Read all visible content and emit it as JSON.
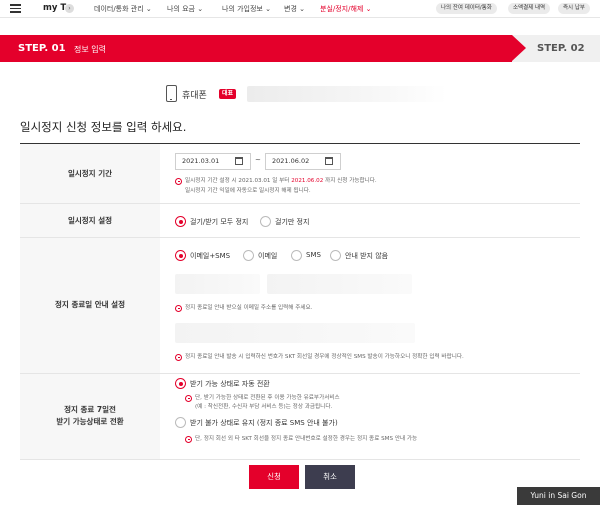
{
  "topnav": {
    "brand": "my T",
    "brand_chevron": "›",
    "items": [
      "데이터/통화 관리 ⌄",
      "나의 요금 ⌄",
      "나의 가입정보 ⌄",
      "변경 ⌄",
      "분실/정지/해제 ⌄"
    ],
    "pills": [
      "나의 잔여 데이터/통화",
      "소액결제 내역",
      "즉시 납부"
    ]
  },
  "steps": {
    "step1": "STEP. 01",
    "step1_label": "정보 입력",
    "step2": "STEP. 02"
  },
  "phone": {
    "label": "휴대폰",
    "badge": "대표"
  },
  "section_title": "일시정지 신청 정보를 입력 하세요.",
  "period": {
    "label": "일시정지 기간",
    "start": "2021.03.01",
    "end": "2021.06.02",
    "tilde": "~",
    "note1_a": "일시정지 기간 설정 시 2021.03.01 일 부터",
    "note1_b": "2021.06.02",
    "note1_c": "까지 신청 가능합니다.",
    "note2": "일시정지 기간 익일에 자동으로 일시정지 해제 됩니다."
  },
  "setting": {
    "label": "일시정지 설정",
    "opt1": "걸기/받기 모두 정지",
    "opt2": "걸기만 정지"
  },
  "end_notice": {
    "label": "정지 종료일 안내 설정",
    "opt1": "이메일+SMS",
    "opt2": "이메일",
    "opt3": "SMS",
    "opt4": "안내 받지 않음",
    "note_email": "정지 종료일 안내 받으실 이메일 주소를 입력해 주세요.",
    "note_sms": "정지 종료일 안내 발송 시 입력하신 번호가 SKT 회선일 경우에 정상적인 SMS 발송이 가능하오니 정확한 입력 바랍니다."
  },
  "conversion": {
    "label_line1": "정지 종료 7일전",
    "label_line2": "받기 가능상태로 전환",
    "opt1": "받기 가능 상태로 자동 전환",
    "note1_line1": "단, 받기 가능한 상태로 전환된 후 이용 가능한 유료부가서비스",
    "note1_line2": "(예 : 착신전환, 수신자 부담 서비스 등)는 정상 과금됩니다.",
    "opt2": "받기 불가 상태로 유지 (정지 종료 SMS 안내 불가)",
    "note2": "단, 정지 회선 외 타 SKT 회선을 정지 종료 안내번호로 설정한 경우는 정지 종료 SMS 안내 가능"
  },
  "buttons": {
    "apply": "신청",
    "cancel": "취소"
  },
  "watermark": "Yuni in Sai Gon",
  "colors": {
    "accent": "#e4002b",
    "cancel_button": "#3d3d4f"
  }
}
